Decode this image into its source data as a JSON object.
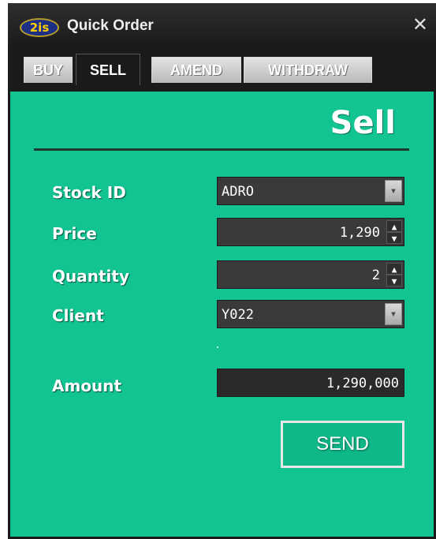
{
  "window": {
    "logo_text": "2is",
    "title": "Quick Order",
    "close_glyph": "✕"
  },
  "tabs": [
    {
      "label": "BUY",
      "active": false
    },
    {
      "label": "SELL",
      "active": true
    },
    {
      "label": "AMEND",
      "active": false
    },
    {
      "label": "WITHDRAW",
      "active": false
    }
  ],
  "form": {
    "heading": "Sell",
    "stock_id": {
      "label": "Stock ID",
      "value": "ADRO"
    },
    "price": {
      "label": "Price",
      "value": "1,290"
    },
    "quantity": {
      "label": "Quantity",
      "value": "2"
    },
    "client": {
      "label": "Client",
      "value": "Y022"
    },
    "amount": {
      "label": "Amount",
      "value": "1,290,000"
    },
    "send_label": "SEND"
  },
  "icons": {
    "dropdown": "chevron-down-icon",
    "spinner_up": "▲",
    "spinner_down": "▼"
  },
  "colors": {
    "panel_bg": "#13c493",
    "window_bg": "#1a1a1a",
    "field_bg": "#3a3a3a"
  }
}
